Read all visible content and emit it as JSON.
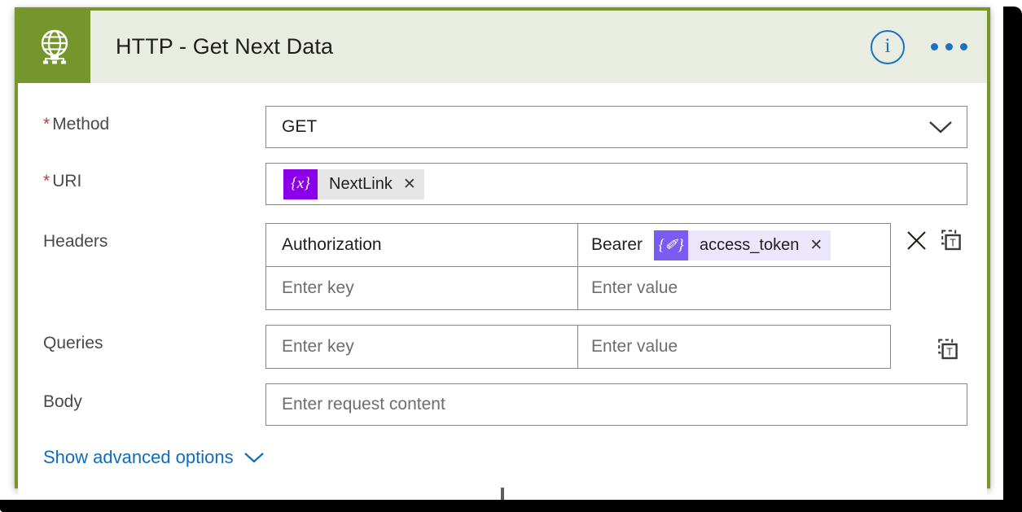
{
  "card": {
    "header": {
      "icon": "globe-network-icon",
      "title": "HTTP - Get Next Data",
      "info_icon": "info-circle-icon",
      "info_glyph": "i",
      "more_icon": "more-horizontal-icon",
      "accent_color": "#74962c",
      "band_color": "#e9ece0",
      "icon_color": "#1b72c2"
    },
    "fields": {
      "method": {
        "label": "Method",
        "required_marker": "*",
        "value": "GET",
        "dropdown_icon": "chevron-down-icon"
      },
      "uri": {
        "label": "URI",
        "required_marker": "*",
        "token": {
          "badge_glyph": "{x}",
          "badge_color": "#8b00e8",
          "chip_color": "#e6e6e6",
          "name": "NextLink",
          "remove_glyph": "✕"
        }
      },
      "headers": {
        "label": "Headers",
        "key_placeholder": "Enter key",
        "value_placeholder": "Enter value",
        "rows": [
          {
            "key": "Authorization",
            "value_prefix": "Bearer",
            "token": {
              "badge_glyph": "{✐}",
              "badge_color": "#7a5cf0",
              "chip_color": "#ece6fd",
              "name": "access_token",
              "remove_glyph": "✕"
            }
          },
          {
            "key": "",
            "value_prefix": "",
            "token": null
          }
        ],
        "delete_icon": "close-x-icon",
        "text_mode_icon": "switch-to-text-mode-icon",
        "text_mode_glyph": "T"
      },
      "queries": {
        "label": "Queries",
        "key_placeholder": "Enter key",
        "value_placeholder": "Enter value",
        "text_mode_icon": "switch-to-text-mode-icon",
        "text_mode_glyph": "T"
      },
      "body": {
        "label": "Body",
        "placeholder": "Enter request content"
      }
    },
    "advanced": {
      "label": "Show advanced options",
      "chevron_icon": "chevron-down-icon",
      "link_color": "#0f6cbd"
    }
  }
}
